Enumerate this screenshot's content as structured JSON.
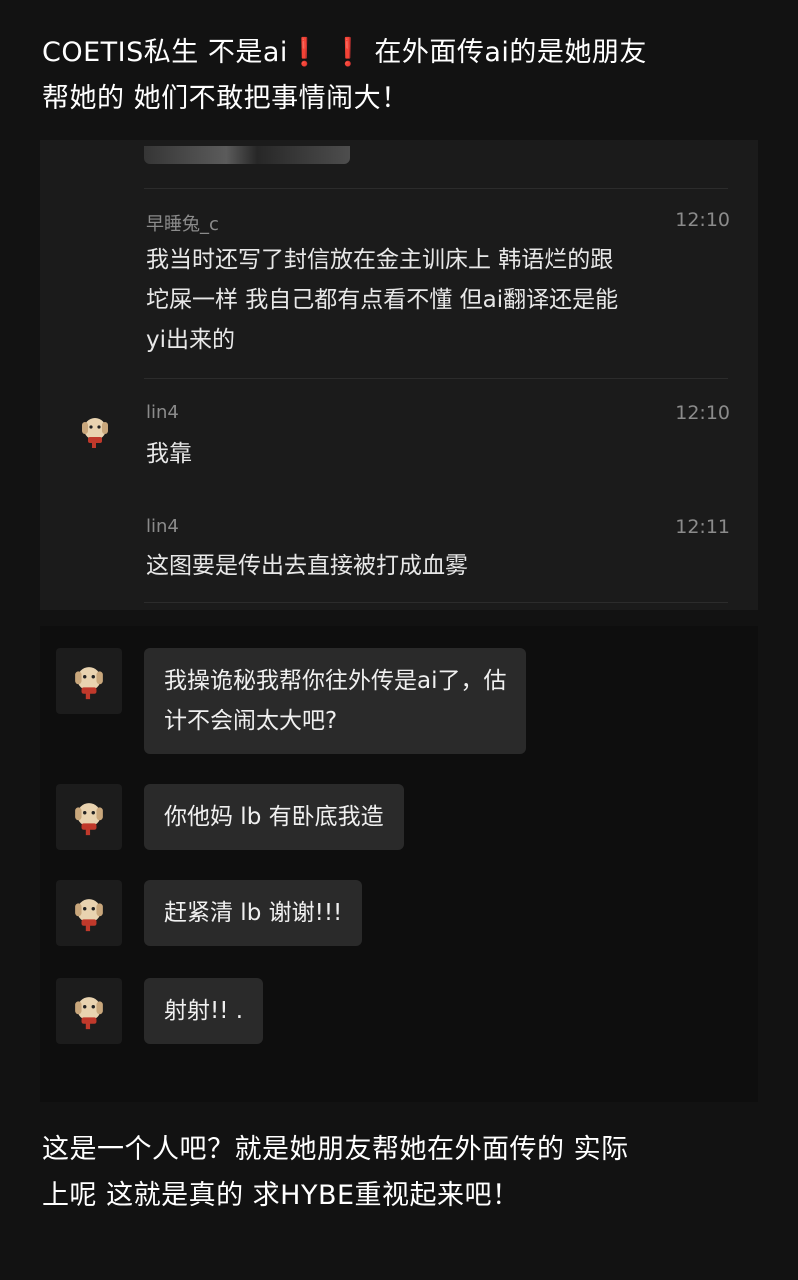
{
  "post": {
    "top_line1_a": "COETIS私生 不是ai",
    "top_line1_excl1": "❗",
    "top_line1_excl2": "❗",
    "top_line1_b": " 在外面传ai的是她朋友",
    "top_line2": "帮她的 她们不敢把事情闹大！",
    "bottom_line1": "这是一个人吧？就是她朋友帮她在外面传的 实际",
    "bottom_line2": "上呢 这就是真的 求HYBE重视起来吧！"
  },
  "screenshot_a": {
    "messages": [
      {
        "name": "早睡兔_c",
        "time": "12:10",
        "lines": [
          "我当时还写了封信放在金主训床上 韩语烂的跟",
          "坨屎一样 我自己都有点看不懂 但ai翻译还是能",
          "yi出来的"
        ]
      },
      {
        "name": "lin4",
        "time": "12:10",
        "lines": [
          "我靠"
        ]
      },
      {
        "name": "lin4",
        "time": "12:11",
        "lines": [
          "这图要是传出去直接被打成血雾"
        ]
      }
    ]
  },
  "screenshot_b": {
    "bubbles": [
      {
        "lines": [
          "我操诡秘我帮你往外传是ai了，估",
          "计不会闹太大吧?"
        ]
      },
      {
        "lines": [
          "你他妈 lb 有卧底我造"
        ]
      },
      {
        "lines": [
          "赶紧清 lb 谢谢!!!"
        ]
      },
      {
        "lines": [
          "射射!! ."
        ]
      }
    ]
  },
  "icons": {
    "avatar": "dog-avatar-icon",
    "exclamation": "red-exclamation-icon"
  },
  "colors": {
    "background": "#121212",
    "exclamation": "#e53935",
    "bubble": "#2a2a2a",
    "meta_text": "#8b8b8b"
  }
}
